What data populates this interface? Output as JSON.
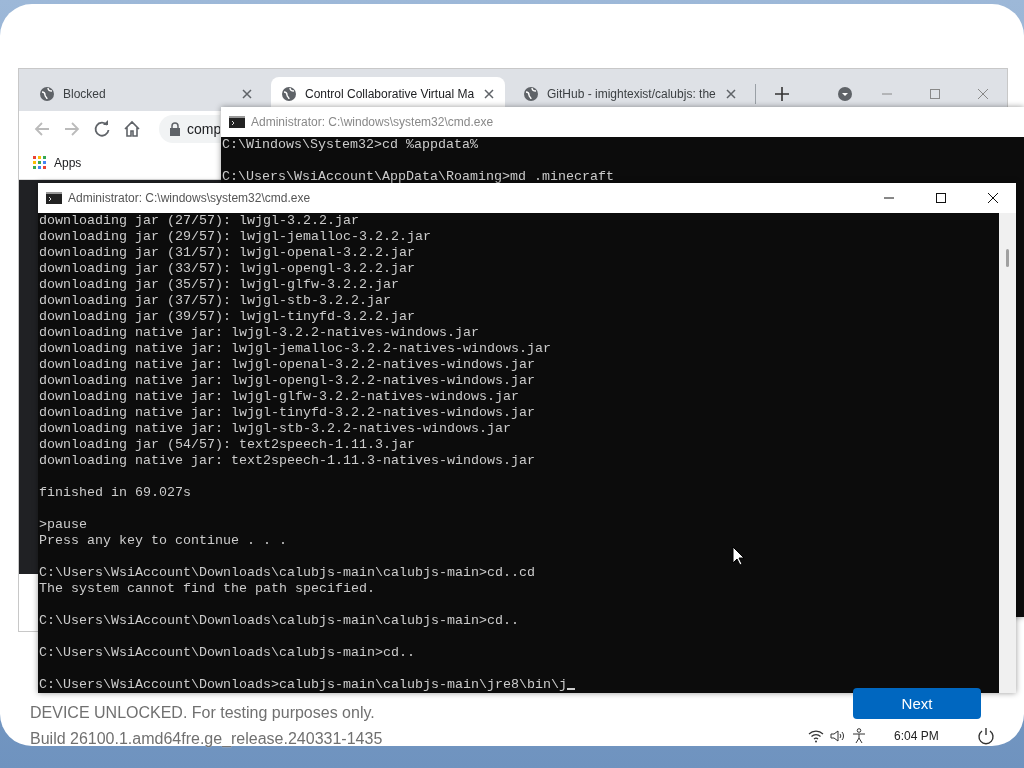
{
  "browser": {
    "tabs": [
      {
        "title": "Blocked",
        "selected": false
      },
      {
        "title": "Control Collaborative Virtual Ma",
        "selected": true
      },
      {
        "title": "GitHub - imightexist/calubjs: the",
        "selected": false
      }
    ],
    "address": "comp",
    "bookmarks": [
      {
        "label": "Apps"
      }
    ]
  },
  "back_console": {
    "title": "Administrator: C:\\windows\\system32\\cmd.exe",
    "blocks": [
      [
        "C:\\Windows\\System32>cd %appdata%"
      ],
      [
        "C:\\Users\\WsiAccount\\AppData\\Roaming>md .minecraft"
      ]
    ]
  },
  "front_console": {
    "title": "Administrator: C:\\windows\\system32\\cmd.exe",
    "blocks": [
      [
        "downloading jar (27/57): lwjgl-3.2.2.jar",
        "downloading jar (29/57): lwjgl-jemalloc-3.2.2.jar",
        "downloading jar (31/57): lwjgl-openal-3.2.2.jar",
        "downloading jar (33/57): lwjgl-opengl-3.2.2.jar",
        "downloading jar (35/57): lwjgl-glfw-3.2.2.jar",
        "downloading jar (37/57): lwjgl-stb-3.2.2.jar",
        "downloading jar (39/57): lwjgl-tinyfd-3.2.2.jar",
        "downloading native jar: lwjgl-3.2.2-natives-windows.jar",
        "downloading native jar: lwjgl-jemalloc-3.2.2-natives-windows.jar",
        "downloading native jar: lwjgl-openal-3.2.2-natives-windows.jar",
        "downloading native jar: lwjgl-opengl-3.2.2-natives-windows.jar",
        "downloading native jar: lwjgl-glfw-3.2.2-natives-windows.jar",
        "downloading native jar: lwjgl-tinyfd-3.2.2-natives-windows.jar",
        "downloading native jar: lwjgl-stb-3.2.2-natives-windows.jar",
        "downloading jar (54/57): text2speech-1.11.3.jar",
        "downloading native jar: text2speech-1.11.3-natives-windows.jar"
      ],
      [
        "finished in 69.027s"
      ],
      [
        ">pause",
        "Press any key to continue . . ."
      ],
      [
        "C:\\Users\\WsiAccount\\Downloads\\calubjs-main\\calubjs-main>cd..cd",
        "The system cannot find the path specified."
      ],
      [
        "C:\\Users\\WsiAccount\\Downloads\\calubjs-main\\calubjs-main>cd.."
      ],
      [
        "C:\\Users\\WsiAccount\\Downloads\\calubjs-main>cd.."
      ],
      [
        "C:\\Users\\WsiAccount\\Downloads>calubjs-main\\calubjs-main\\jre8\\bin\\j"
      ]
    ]
  },
  "setup": {
    "notice_lines": [
      "DEVICE UNLOCKED. For testing purposes only.",
      "Build 26100.1.amd64fre.ge_release.240331-1435"
    ],
    "next_button": "Next",
    "clock": "6:04 PM"
  }
}
